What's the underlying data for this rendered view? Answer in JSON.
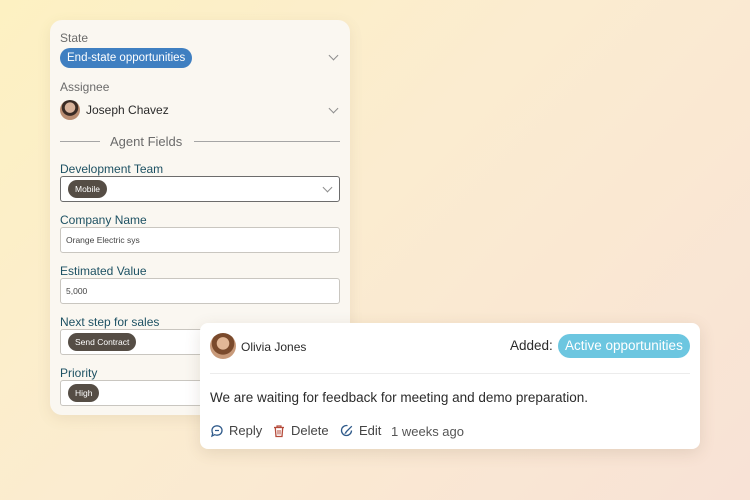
{
  "form": {
    "state_label": "State",
    "state_value": "End-state opportunities",
    "assignee_label": "Assignee",
    "assignee_name": "Joseph Chavez",
    "section_title": "Agent Fields",
    "development_team_label": "Development Team",
    "development_team_value": "Mobile",
    "company_name_label": "Company Name",
    "company_name_value": "Orange Electric sys",
    "estimated_value_label": "Estimated Value",
    "estimated_value_value": "5,000",
    "next_step_label": "Next step for sales",
    "next_step_value": "Send Contract",
    "priority_label": "Priority",
    "priority_value": "High"
  },
  "comment": {
    "author": "Olivia Jones",
    "added_label": "Added:",
    "added_badge": "Active opportunities",
    "text": "We are waiting for feedback for meeting and demo preparation.",
    "reply_label": "Reply",
    "delete_label": "Delete",
    "edit_label": "Edit",
    "time_ago": "1 weeks ago"
  },
  "icons": {
    "reply": "reply-icon",
    "delete": "trash-icon",
    "edit": "edit-icon",
    "dropdown": "chevron-down-icon"
  },
  "colors": {
    "state_pill": "#3f7fc1",
    "active_pill": "#6cc6e0",
    "tag": "#554d45",
    "field_label": "#1d5163"
  }
}
